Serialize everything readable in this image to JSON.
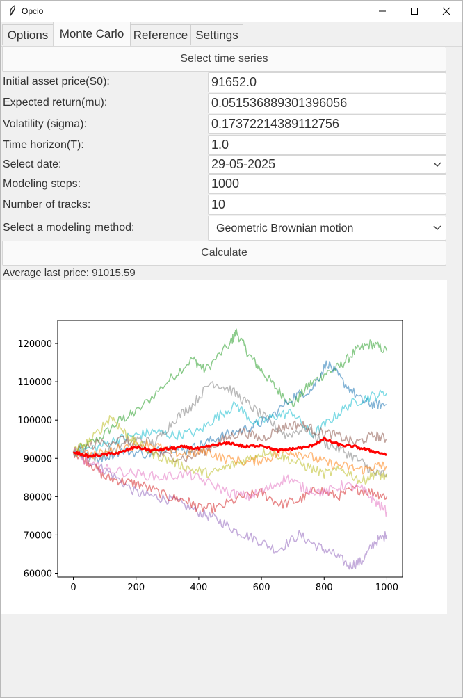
{
  "window": {
    "title": "Opcio"
  },
  "tabs": [
    {
      "label": "Options"
    },
    {
      "label": "Monte Carlo"
    },
    {
      "label": "Reference"
    },
    {
      "label": "Settings"
    }
  ],
  "form": {
    "select_series_label": "Select time series",
    "s0_label": "Initial asset price(S0):",
    "s0_value": "91652.0",
    "mu_label": "Expected return(mu):",
    "mu_value": "0.05153688930139605​6",
    "sigma_label": "Volatility (sigma):",
    "sigma_value": "0.17372214389112756",
    "t_label": "Time horizon(T):",
    "t_value": "1.0",
    "date_label": "Select date:",
    "date_value": "29-05-2025",
    "steps_label": "Modeling steps:",
    "steps_value": "1000",
    "tracks_label": "Number of tracks:",
    "tracks_value": "10",
    "method_label": "Select a modeling method:",
    "method_value": "Geometric Brownian motion",
    "calculate_label": "Calculate"
  },
  "result": {
    "text": "Average last price: 91015.59"
  },
  "chart_data": {
    "type": "line",
    "xlim": [
      -50,
      1050
    ],
    "ylim": [
      59000,
      126000
    ],
    "x_ticks": [
      "0",
      "200",
      "400",
      "600",
      "800",
      "1000"
    ],
    "y_ticks": [
      "60000",
      "70000",
      "80000",
      "90000",
      "100000",
      "110000",
      "120000"
    ],
    "x_tick_values": [
      0,
      200,
      400,
      600,
      800,
      1000
    ],
    "y_tick_values": [
      60000,
      70000,
      80000,
      90000,
      100000,
      110000,
      120000
    ],
    "series": [
      {
        "color": "#2ca02c",
        "points": [
          [
            0,
            91652
          ],
          [
            80,
            95000
          ],
          [
            150,
            100000
          ],
          [
            200,
            102000
          ],
          [
            300,
            110000
          ],
          [
            380,
            116000
          ],
          [
            420,
            113000
          ],
          [
            500,
            120000
          ],
          [
            520,
            123000
          ],
          [
            560,
            117000
          ],
          [
            600,
            113000
          ],
          [
            650,
            108000
          ],
          [
            700,
            104000
          ],
          [
            750,
            109000
          ],
          [
            800,
            112000
          ],
          [
            850,
            114000
          ],
          [
            900,
            118000
          ],
          [
            950,
            120000
          ],
          [
            1000,
            118000
          ]
        ]
      },
      {
        "color": "#9467bd",
        "points": [
          [
            0,
            91652
          ],
          [
            60,
            89000
          ],
          [
            120,
            86000
          ],
          [
            200,
            81000
          ],
          [
            260,
            80000
          ],
          [
            320,
            79000
          ],
          [
            400,
            76000
          ],
          [
            460,
            74000
          ],
          [
            520,
            71000
          ],
          [
            580,
            69000
          ],
          [
            650,
            66000
          ],
          [
            720,
            70000
          ],
          [
            780,
            67000
          ],
          [
            830,
            65000
          ],
          [
            880,
            62000
          ],
          [
            920,
            63000
          ],
          [
            960,
            68000
          ],
          [
            1000,
            70000
          ]
        ]
      },
      {
        "color": "#d62728",
        "points": [
          [
            0,
            91652
          ],
          [
            50,
            89000
          ],
          [
            100,
            85000
          ],
          [
            160,
            84000
          ],
          [
            220,
            83000
          ],
          [
            300,
            80000
          ],
          [
            360,
            79000
          ],
          [
            400,
            77000
          ],
          [
            460,
            77000
          ],
          [
            540,
            80000
          ],
          [
            600,
            81000
          ],
          [
            660,
            78000
          ],
          [
            720,
            79000
          ],
          [
            780,
            82000
          ],
          [
            840,
            80000
          ],
          [
            900,
            82000
          ],
          [
            960,
            81000
          ],
          [
            1000,
            80000
          ]
        ]
      },
      {
        "color": "#1f77b4",
        "points": [
          [
            0,
            91652
          ],
          [
            80,
            90000
          ],
          [
            160,
            92000
          ],
          [
            240,
            91000
          ],
          [
            300,
            93000
          ],
          [
            360,
            92000
          ],
          [
            420,
            94000
          ],
          [
            480,
            96000
          ],
          [
            560,
            98000
          ],
          [
            620,
            100000
          ],
          [
            700,
            106000
          ],
          [
            760,
            108000
          ],
          [
            810,
            115000
          ],
          [
            860,
            110000
          ],
          [
            920,
            105000
          ],
          [
            960,
            104000
          ],
          [
            1000,
            104000
          ]
        ]
      },
      {
        "color": "#17becf",
        "points": [
          [
            0,
            91652
          ],
          [
            80,
            93000
          ],
          [
            140,
            95000
          ],
          [
            200,
            96000
          ],
          [
            260,
            97000
          ],
          [
            320,
            96000
          ],
          [
            400,
            97000
          ],
          [
            460,
            101000
          ],
          [
            520,
            104000
          ],
          [
            580,
            99000
          ],
          [
            640,
            101000
          ],
          [
            700,
            102000
          ],
          [
            760,
            96000
          ],
          [
            820,
            100000
          ],
          [
            880,
            104000
          ],
          [
            940,
            106000
          ],
          [
            1000,
            107000
          ]
        ]
      },
      {
        "color": "#7f7f7f",
        "points": [
          [
            0,
            91652
          ],
          [
            60,
            90000
          ],
          [
            120,
            92000
          ],
          [
            200,
            95000
          ],
          [
            260,
            94000
          ],
          [
            320,
            100000
          ],
          [
            380,
            104000
          ],
          [
            440,
            110000
          ],
          [
            500,
            108000
          ],
          [
            560,
            104000
          ],
          [
            620,
            100000
          ],
          [
            680,
            96000
          ],
          [
            740,
            98000
          ],
          [
            800,
            94000
          ],
          [
            860,
            92000
          ],
          [
            920,
            89000
          ],
          [
            960,
            86000
          ],
          [
            1000,
            86000
          ]
        ]
      },
      {
        "color": "#8c564b",
        "points": [
          [
            0,
            91652
          ],
          [
            80,
            94000
          ],
          [
            160,
            95000
          ],
          [
            220,
            92000
          ],
          [
            280,
            91000
          ],
          [
            360,
            90000
          ],
          [
            420,
            92000
          ],
          [
            480,
            95000
          ],
          [
            540,
            97000
          ],
          [
            600,
            95000
          ],
          [
            660,
            98000
          ],
          [
            720,
            99000
          ],
          [
            780,
            97000
          ],
          [
            840,
            96000
          ],
          [
            900,
            94000
          ],
          [
            960,
            96000
          ],
          [
            1000,
            95000
          ]
        ]
      },
      {
        "color": "#ff7f0e",
        "points": [
          [
            0,
            91652
          ],
          [
            80,
            91000
          ],
          [
            160,
            93000
          ],
          [
            240,
            94000
          ],
          [
            300,
            92000
          ],
          [
            360,
            91000
          ],
          [
            420,
            92000
          ],
          [
            480,
            90000
          ],
          [
            560,
            89000
          ],
          [
            620,
            90000
          ],
          [
            680,
            92000
          ],
          [
            740,
            91000
          ],
          [
            800,
            89000
          ],
          [
            860,
            88000
          ],
          [
            920,
            87000
          ],
          [
            970,
            88000
          ],
          [
            1000,
            88000
          ]
        ]
      },
      {
        "color": "#bcbd22",
        "points": [
          [
            0,
            91652
          ],
          [
            60,
            95000
          ],
          [
            120,
            101000
          ],
          [
            160,
            97000
          ],
          [
            200,
            94000
          ],
          [
            260,
            91000
          ],
          [
            320,
            89000
          ],
          [
            380,
            87000
          ],
          [
            440,
            86000
          ],
          [
            500,
            88000
          ],
          [
            560,
            90000
          ],
          [
            620,
            92000
          ],
          [
            680,
            90000
          ],
          [
            740,
            88000
          ],
          [
            800,
            86000
          ],
          [
            860,
            87000
          ],
          [
            920,
            84000
          ],
          [
            960,
            86000
          ],
          [
            1000,
            85000
          ]
        ]
      },
      {
        "color": "#e377c2",
        "points": [
          [
            0,
            91652
          ],
          [
            60,
            88000
          ],
          [
            120,
            87000
          ],
          [
            200,
            86000
          ],
          [
            280,
            85000
          ],
          [
            360,
            86000
          ],
          [
            420,
            84000
          ],
          [
            500,
            81000
          ],
          [
            560,
            80000
          ],
          [
            620,
            82000
          ],
          [
            680,
            85000
          ],
          [
            740,
            82000
          ],
          [
            800,
            81000
          ],
          [
            860,
            83000
          ],
          [
            920,
            82000
          ],
          [
            960,
            79000
          ],
          [
            1000,
            76000
          ]
        ]
      }
    ],
    "mean_series": {
      "color": "#ff0000",
      "points": [
        [
          0,
          91652
        ],
        [
          50,
          90500
        ],
        [
          100,
          91000
        ],
        [
          150,
          91500
        ],
        [
          200,
          93000
        ],
        [
          250,
          92000
        ],
        [
          300,
          92500
        ],
        [
          350,
          93000
        ],
        [
          400,
          92500
        ],
        [
          450,
          93500
        ],
        [
          500,
          94000
        ],
        [
          550,
          93000
        ],
        [
          600,
          93500
        ],
        [
          650,
          92000
        ],
        [
          700,
          92500
        ],
        [
          750,
          93000
        ],
        [
          800,
          95000
        ],
        [
          850,
          93500
        ],
        [
          900,
          93000
        ],
        [
          950,
          92000
        ],
        [
          1000,
          91000
        ]
      ]
    }
  }
}
